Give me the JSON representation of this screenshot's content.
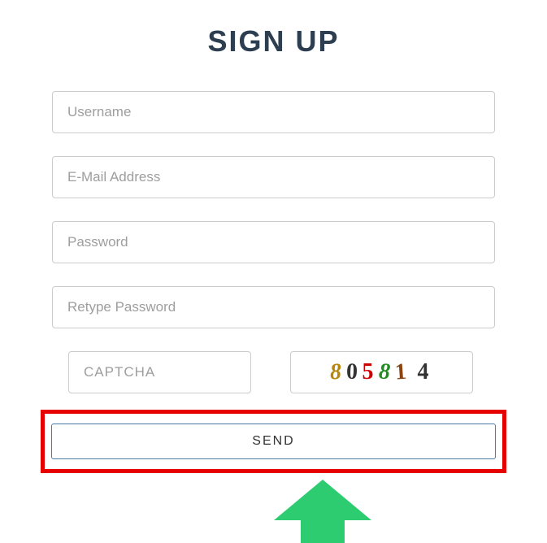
{
  "title": "SIGN UP",
  "fields": {
    "username": {
      "placeholder": "Username",
      "value": ""
    },
    "email": {
      "placeholder": "E-Mail Address",
      "value": ""
    },
    "password": {
      "placeholder": "Password",
      "value": ""
    },
    "retype": {
      "placeholder": "Retype Password",
      "value": ""
    },
    "captcha": {
      "placeholder": "CAPTCHA",
      "value": ""
    }
  },
  "captcha_code": {
    "d1": "8",
    "d2": "0",
    "d3": "5",
    "d4": "8",
    "d5": "1",
    "d6": "4"
  },
  "send_label": "SEND"
}
